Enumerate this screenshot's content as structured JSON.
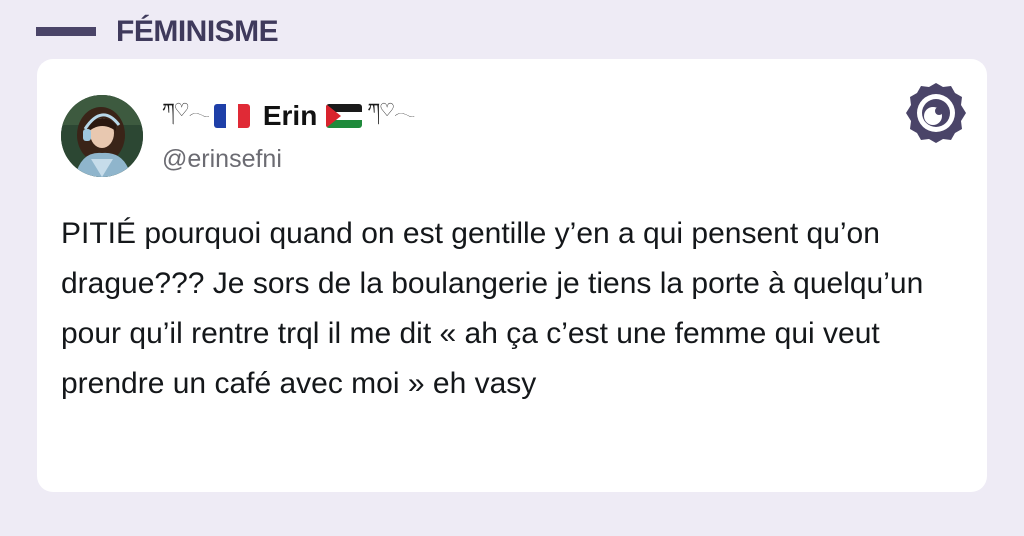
{
  "header": {
    "category": "FÉMINISME"
  },
  "tweet": {
    "display_name": "Erin",
    "deco_left": "ཀ♡𓂃",
    "deco_right": "ཀ♡𓂃",
    "flag_left": "france-flag",
    "flag_right": "palestine-flag",
    "handle": "@erinsefni",
    "text": "PITIÉ pourquoi quand on est gentille y’en a qui pensent qu’on drague??? Je sors de la boulangerie je tiens la porte à quelqu’un pour qu’il rentre trql il me dit « ah ça c’est une femme qui veut prendre un café avec moi » eh vasy"
  },
  "brand": {
    "icon": "brand-logo-icon",
    "color": "#4a4468"
  },
  "colors": {
    "background": "#eeebf5",
    "card": "#ffffff",
    "accent": "#4a4468"
  }
}
